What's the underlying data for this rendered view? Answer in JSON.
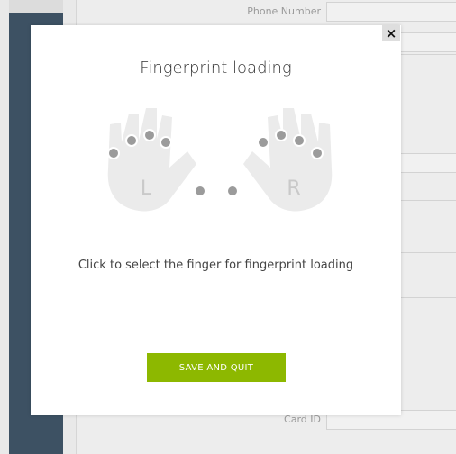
{
  "background": {
    "phone_label": "Phone Number",
    "card_label": "Card ID"
  },
  "modal": {
    "title": "Fingerprint loading",
    "close_label": "×",
    "left_hand_label": "L",
    "right_hand_label": "R",
    "instruction": "Click to select the finger for fingerprint loading",
    "save_button": "SAVE AND QUIT"
  },
  "colors": {
    "accent": "#8db800",
    "hand": "#ebebeb",
    "finger_dot": "#9b9b9b",
    "sidebar": "#3d5163"
  }
}
